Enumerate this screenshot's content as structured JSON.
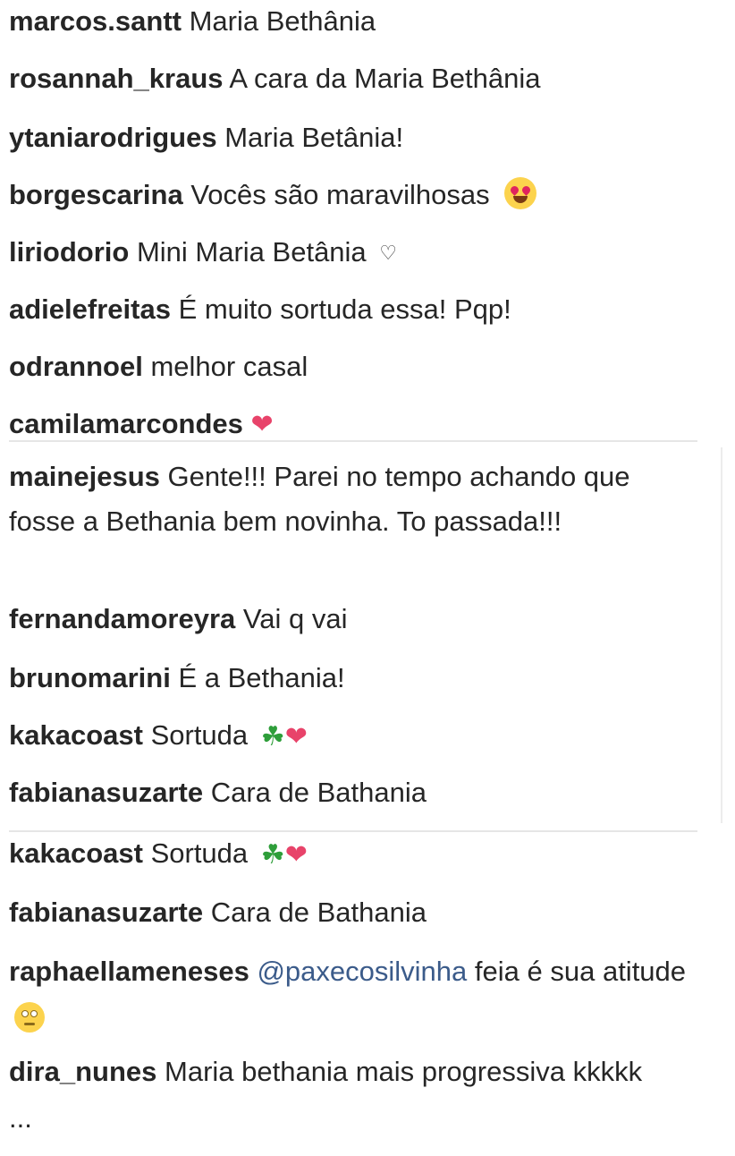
{
  "group1": [
    {
      "user": "marcos.santt",
      "text": "Maria Bethânia"
    },
    {
      "user": "rosannah_kraus",
      "text": "A cara da Maria Bethânia"
    },
    {
      "user": "ytaniarodrigues",
      "text": "Maria Betânia!"
    },
    {
      "user": "borgescarina",
      "text": "Vocês são maravilhosas",
      "emoji": "heart-eyes-icon"
    },
    {
      "user": "liriodorio",
      "text": "Mini Maria Betânia",
      "emoji": "♡"
    },
    {
      "user": "adielefreitas",
      "text": "É muito sortuda essa! Pqp!"
    },
    {
      "user": "odrannoel",
      "text": "melhor casal"
    },
    {
      "user": "camilamarcondes",
      "text": "",
      "emoji": "❤"
    }
  ],
  "group2": [
    {
      "user": "mainejesus",
      "text": "Gente!!! Parei no tempo achando que fosse a Bethania bem novinha. To passada!!!"
    },
    {
      "user": "fernandamoreyra",
      "text": "Vai q vai"
    },
    {
      "user": "brunomarini",
      "text": "É a Bethania!"
    },
    {
      "user": "kakacoast",
      "text": "Sortuda",
      "emoji": "☘❤"
    },
    {
      "user": "fabianasuzarte",
      "text": "Cara de Bathania"
    }
  ],
  "group3": [
    {
      "user": "kakacoast",
      "text": "Sortuda",
      "emoji": "☘❤"
    },
    {
      "user": "fabianasuzarte",
      "text": "Cara de Bathania"
    },
    {
      "user": "raphaellameneses",
      "mention": "@paxecosilvinha",
      "text": "feia é sua atitude",
      "emoji": "eye-roll-icon"
    },
    {
      "user": "dira_nunes",
      "text": "Maria bethania mais progressiva kkkkk ..."
    }
  ]
}
